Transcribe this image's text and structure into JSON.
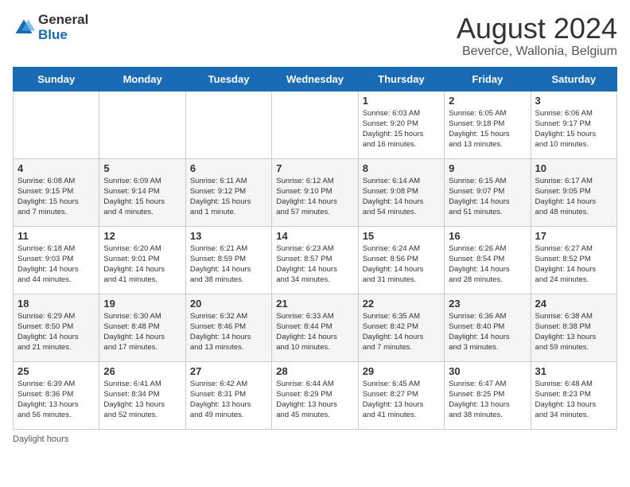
{
  "logo": {
    "text_general": "General",
    "text_blue": "Blue"
  },
  "header": {
    "title": "August 2024",
    "subtitle": "Beverce, Wallonia, Belgium"
  },
  "days_of_week": [
    "Sunday",
    "Monday",
    "Tuesday",
    "Wednesday",
    "Thursday",
    "Friday",
    "Saturday"
  ],
  "weeks": [
    [
      {
        "day": "",
        "info": ""
      },
      {
        "day": "",
        "info": ""
      },
      {
        "day": "",
        "info": ""
      },
      {
        "day": "",
        "info": ""
      },
      {
        "day": "1",
        "info": "Sunrise: 6:03 AM\nSunset: 9:20 PM\nDaylight: 15 hours\nand 16 minutes."
      },
      {
        "day": "2",
        "info": "Sunrise: 6:05 AM\nSunset: 9:18 PM\nDaylight: 15 hours\nand 13 minutes."
      },
      {
        "day": "3",
        "info": "Sunrise: 6:06 AM\nSunset: 9:17 PM\nDaylight: 15 hours\nand 10 minutes."
      }
    ],
    [
      {
        "day": "4",
        "info": "Sunrise: 6:08 AM\nSunset: 9:15 PM\nDaylight: 15 hours\nand 7 minutes."
      },
      {
        "day": "5",
        "info": "Sunrise: 6:09 AM\nSunset: 9:14 PM\nDaylight: 15 hours\nand 4 minutes."
      },
      {
        "day": "6",
        "info": "Sunrise: 6:11 AM\nSunset: 9:12 PM\nDaylight: 15 hours\nand 1 minute."
      },
      {
        "day": "7",
        "info": "Sunrise: 6:12 AM\nSunset: 9:10 PM\nDaylight: 14 hours\nand 57 minutes."
      },
      {
        "day": "8",
        "info": "Sunrise: 6:14 AM\nSunset: 9:08 PM\nDaylight: 14 hours\nand 54 minutes."
      },
      {
        "day": "9",
        "info": "Sunrise: 6:15 AM\nSunset: 9:07 PM\nDaylight: 14 hours\nand 51 minutes."
      },
      {
        "day": "10",
        "info": "Sunrise: 6:17 AM\nSunset: 9:05 PM\nDaylight: 14 hours\nand 48 minutes."
      }
    ],
    [
      {
        "day": "11",
        "info": "Sunrise: 6:18 AM\nSunset: 9:03 PM\nDaylight: 14 hours\nand 44 minutes."
      },
      {
        "day": "12",
        "info": "Sunrise: 6:20 AM\nSunset: 9:01 PM\nDaylight: 14 hours\nand 41 minutes."
      },
      {
        "day": "13",
        "info": "Sunrise: 6:21 AM\nSunset: 8:59 PM\nDaylight: 14 hours\nand 38 minutes."
      },
      {
        "day": "14",
        "info": "Sunrise: 6:23 AM\nSunset: 8:57 PM\nDaylight: 14 hours\nand 34 minutes."
      },
      {
        "day": "15",
        "info": "Sunrise: 6:24 AM\nSunset: 8:56 PM\nDaylight: 14 hours\nand 31 minutes."
      },
      {
        "day": "16",
        "info": "Sunrise: 6:26 AM\nSunset: 8:54 PM\nDaylight: 14 hours\nand 28 minutes."
      },
      {
        "day": "17",
        "info": "Sunrise: 6:27 AM\nSunset: 8:52 PM\nDaylight: 14 hours\nand 24 minutes."
      }
    ],
    [
      {
        "day": "18",
        "info": "Sunrise: 6:29 AM\nSunset: 8:50 PM\nDaylight: 14 hours\nand 21 minutes."
      },
      {
        "day": "19",
        "info": "Sunrise: 6:30 AM\nSunset: 8:48 PM\nDaylight: 14 hours\nand 17 minutes."
      },
      {
        "day": "20",
        "info": "Sunrise: 6:32 AM\nSunset: 8:46 PM\nDaylight: 14 hours\nand 13 minutes."
      },
      {
        "day": "21",
        "info": "Sunrise: 6:33 AM\nSunset: 8:44 PM\nDaylight: 14 hours\nand 10 minutes."
      },
      {
        "day": "22",
        "info": "Sunrise: 6:35 AM\nSunset: 8:42 PM\nDaylight: 14 hours\nand 7 minutes."
      },
      {
        "day": "23",
        "info": "Sunrise: 6:36 AM\nSunset: 8:40 PM\nDaylight: 14 hours\nand 3 minutes."
      },
      {
        "day": "24",
        "info": "Sunrise: 6:38 AM\nSunset: 8:38 PM\nDaylight: 13 hours\nand 59 minutes."
      }
    ],
    [
      {
        "day": "25",
        "info": "Sunrise: 6:39 AM\nSunset: 8:36 PM\nDaylight: 13 hours\nand 56 minutes."
      },
      {
        "day": "26",
        "info": "Sunrise: 6:41 AM\nSunset: 8:34 PM\nDaylight: 13 hours\nand 52 minutes."
      },
      {
        "day": "27",
        "info": "Sunrise: 6:42 AM\nSunset: 8:31 PM\nDaylight: 13 hours\nand 49 minutes."
      },
      {
        "day": "28",
        "info": "Sunrise: 6:44 AM\nSunset: 8:29 PM\nDaylight: 13 hours\nand 45 minutes."
      },
      {
        "day": "29",
        "info": "Sunrise: 6:45 AM\nSunset: 8:27 PM\nDaylight: 13 hours\nand 41 minutes."
      },
      {
        "day": "30",
        "info": "Sunrise: 6:47 AM\nSunset: 8:25 PM\nDaylight: 13 hours\nand 38 minutes."
      },
      {
        "day": "31",
        "info": "Sunrise: 6:48 AM\nSunset: 8:23 PM\nDaylight: 13 hours\nand 34 minutes."
      }
    ]
  ],
  "footer": {
    "note": "Daylight hours"
  }
}
